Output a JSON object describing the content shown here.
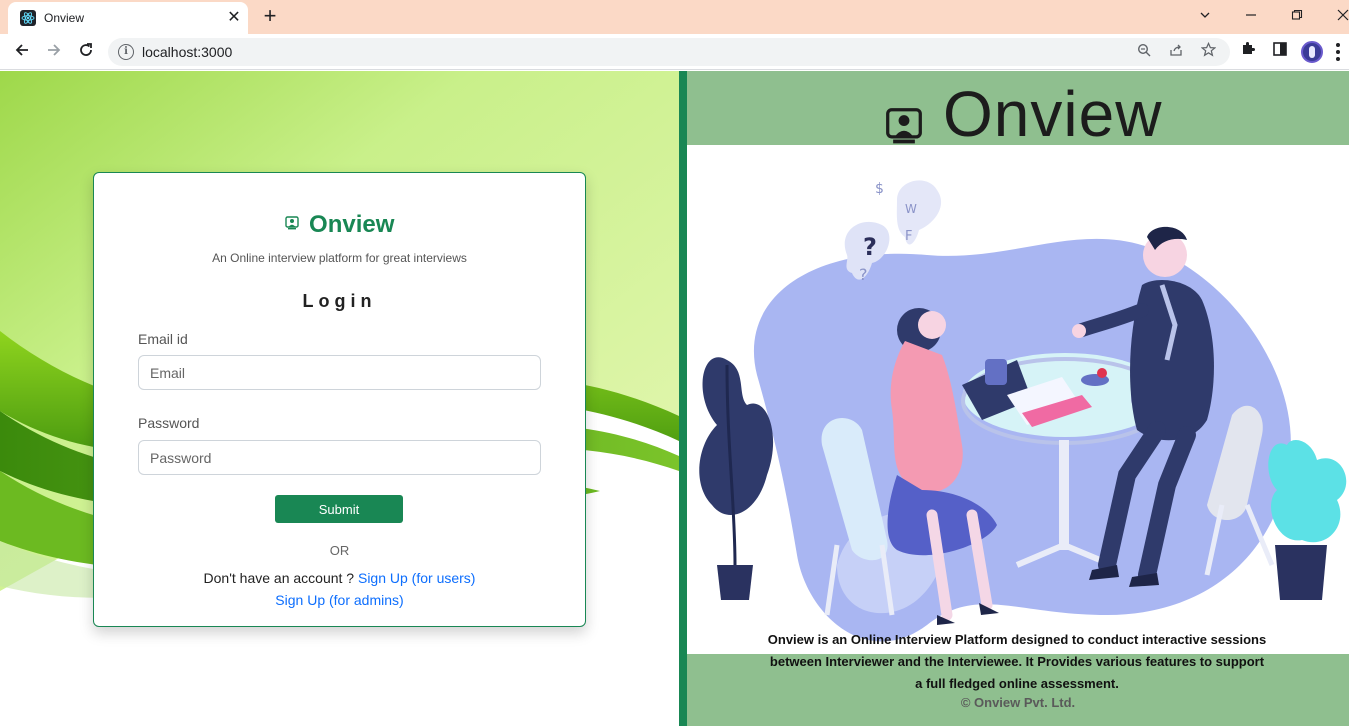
{
  "browser": {
    "tab_title": "Onview",
    "url": "localhost:3000",
    "new_tab": "+",
    "tab_close": "✕"
  },
  "login": {
    "brand": "Onview",
    "tagline": "An Online interview platform for great interviews",
    "heading": "Login",
    "email_label": "Email id",
    "email_placeholder": "Email",
    "email_value": "",
    "password_label": "Password",
    "password_placeholder": "Password",
    "password_value": "",
    "submit_label": "Submit",
    "or_text": "OR",
    "no_account_text": "Don't have an account ? ",
    "signup_users": "Sign Up (for users)",
    "signup_admins": "Sign Up (for admins)"
  },
  "hero": {
    "title": "Onview",
    "description": "Onview is an Online Interview Platform designed to conduct interactive sessions between Interviewer and the Interviewee. It Provides various features to support a full fledged online assessment.",
    "copyright": "© Onview Pvt. Ltd."
  },
  "colors": {
    "brand_green": "#198754",
    "header_green": "#8fbf8f",
    "tab_bar": "#fbd9c6",
    "link_blue": "#0d6efd"
  },
  "icons": [
    "react-favicon",
    "back-arrow-icon",
    "forward-arrow-icon",
    "reload-icon",
    "info-icon",
    "zoom-icon",
    "share-icon",
    "star-icon",
    "extensions-icon",
    "sidepanel-icon",
    "profile-avatar",
    "menu-icon",
    "chevron-down-icon",
    "minimize-icon",
    "restore-icon",
    "close-icon",
    "interview-logo-icon"
  ]
}
